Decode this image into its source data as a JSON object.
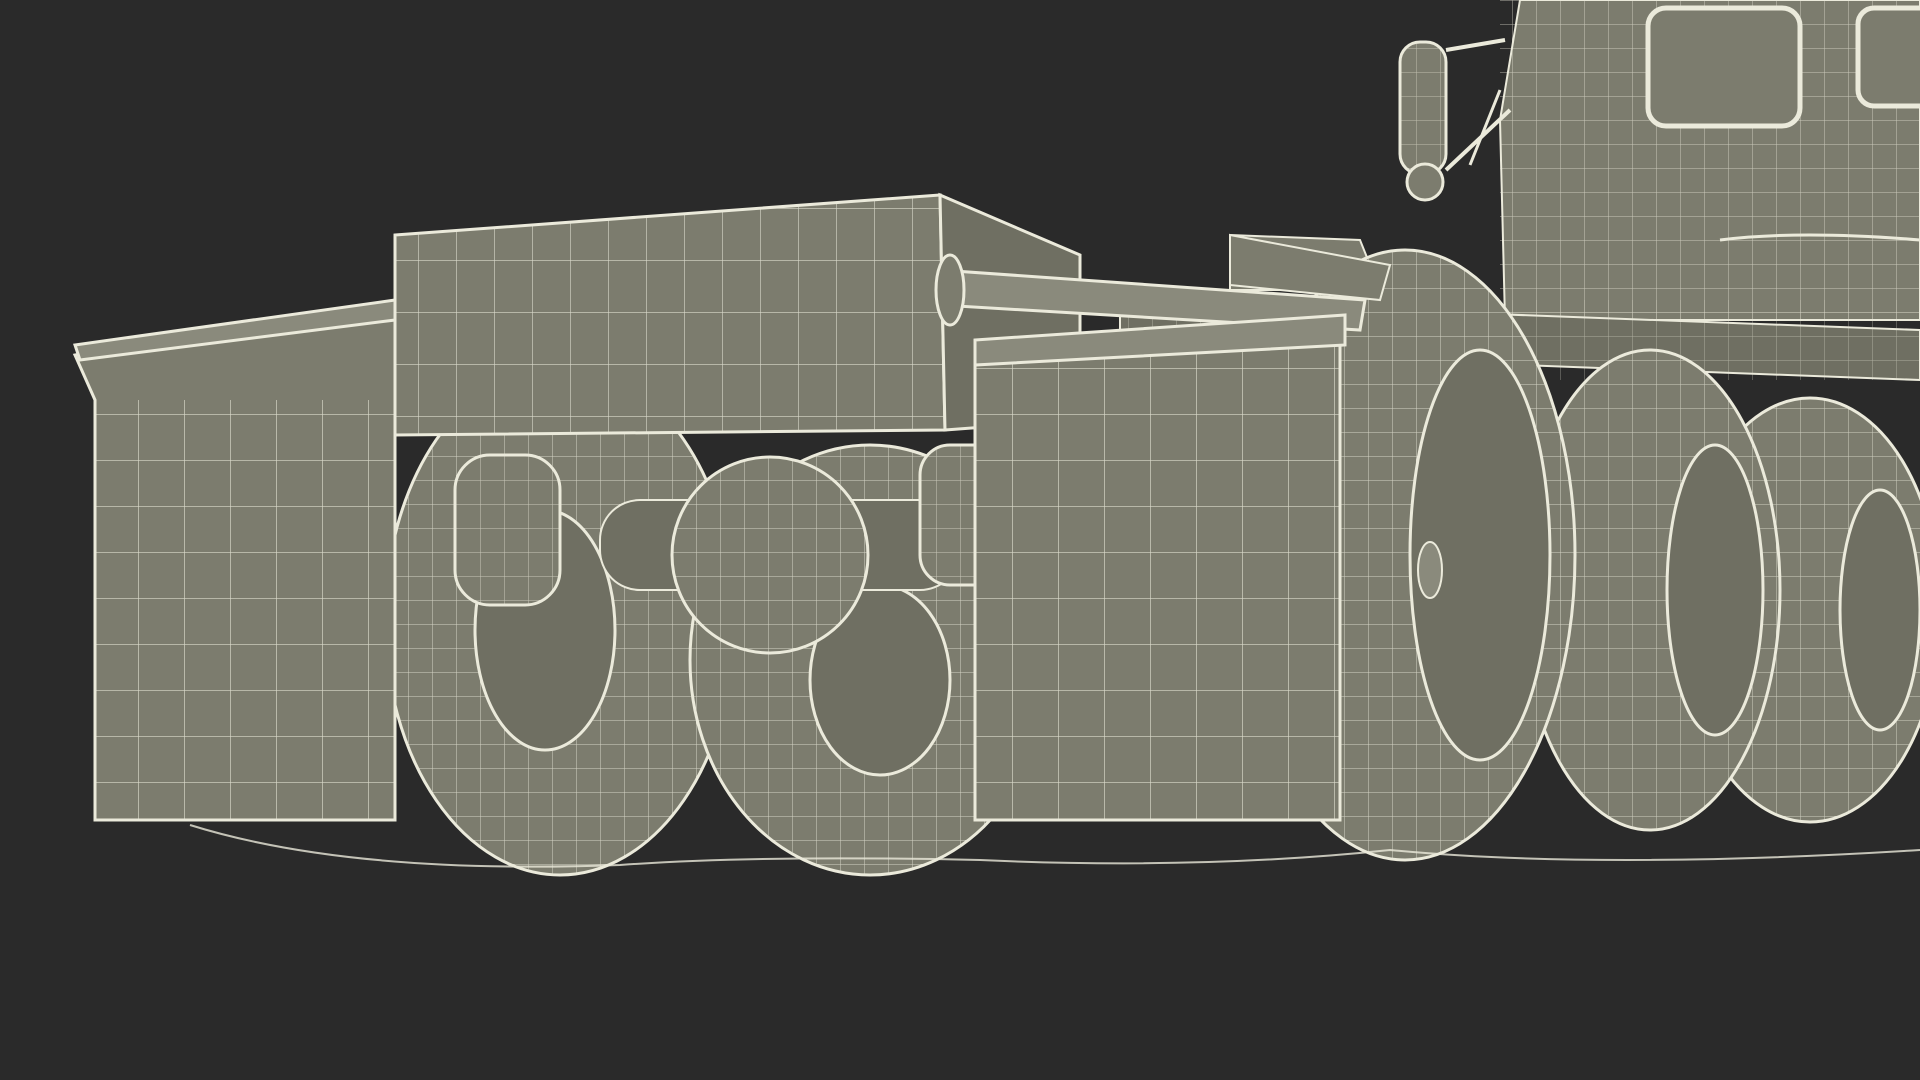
{
  "scene": {
    "subject": "wireframe-truck-rear-chassis",
    "colors": {
      "background": "#2a2a2a",
      "surface": "#7c7c6e",
      "surface_dark": "#6f6f62",
      "surface_light": "#8a8a7c",
      "wire": "#ebeadb",
      "shadow": "#4f4f46"
    }
  }
}
